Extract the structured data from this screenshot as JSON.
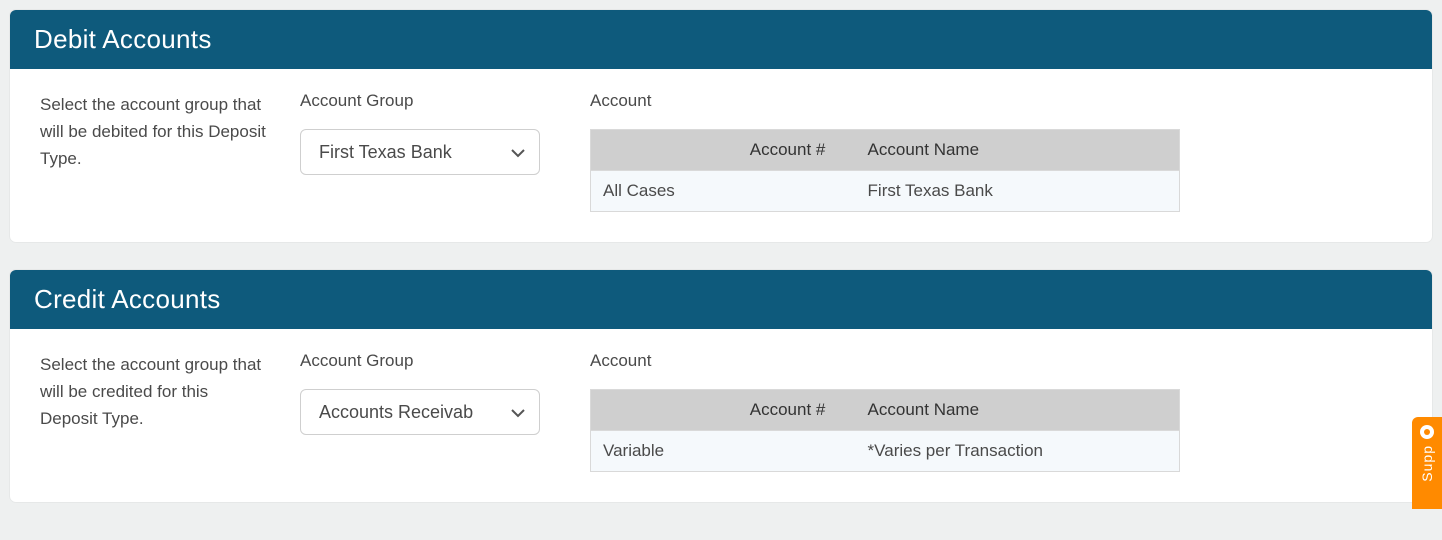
{
  "debit": {
    "title": "Debit Accounts",
    "help": "Select the account group that will be debited for this Deposit Type.",
    "group_label": "Account Group",
    "group_value": "First Texas Bank",
    "account_label": "Account",
    "table": {
      "col_case": "",
      "col_num": "Account #",
      "col_name": "Account Name",
      "row_case": "All Cases",
      "row_num": "",
      "row_name": "First Texas Bank"
    }
  },
  "credit": {
    "title": "Credit Accounts",
    "help": "Select the account group that will be credited for this Deposit Type.",
    "group_label": "Account Group",
    "group_value": "Accounts Receivab",
    "account_label": "Account",
    "table": {
      "col_case": "",
      "col_num": "Account #",
      "col_name": "Account Name",
      "row_case": "Variable",
      "row_num": "",
      "row_name": "*Varies per Transaction"
    }
  },
  "support": {
    "label": "Supp"
  }
}
